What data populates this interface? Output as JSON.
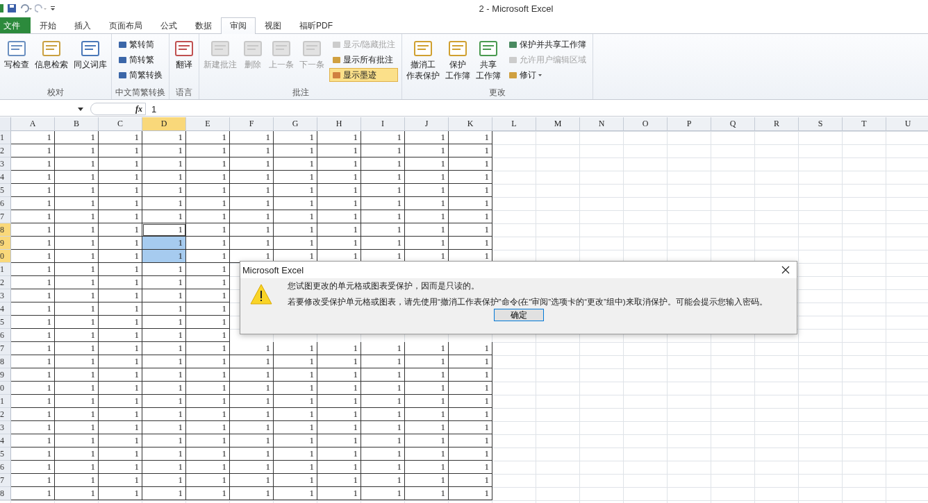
{
  "window": {
    "title": "2 - Microsoft Excel"
  },
  "tabs": [
    {
      "label": "文件",
      "kind": "file",
      "selected": false
    },
    {
      "label": "开始",
      "kind": "tab",
      "selected": false
    },
    {
      "label": "插入",
      "kind": "tab",
      "selected": false
    },
    {
      "label": "页面布局",
      "kind": "tab",
      "selected": false
    },
    {
      "label": "公式",
      "kind": "tab",
      "selected": false
    },
    {
      "label": "数据",
      "kind": "tab",
      "selected": false
    },
    {
      "label": "审阅",
      "kind": "tab",
      "selected": true
    },
    {
      "label": "视图",
      "kind": "tab",
      "selected": false
    },
    {
      "label": "福昕PDF",
      "kind": "tab",
      "selected": false
    }
  ],
  "ribbon": {
    "groups": [
      {
        "label": "校对",
        "large": [
          {
            "lines": [
              "写检查"
            ],
            "disabled": false
          },
          {
            "lines": [
              "信息检索"
            ],
            "disabled": false
          },
          {
            "lines": [
              "同义词库"
            ],
            "disabled": false
          }
        ]
      },
      {
        "label": "中文简繁转换",
        "small": [
          {
            "label": "繁转简",
            "disabled": false,
            "on": false
          },
          {
            "label": "简转繁",
            "disabled": false,
            "on": false
          },
          {
            "label": "简繁转换",
            "disabled": false,
            "on": false
          }
        ]
      },
      {
        "label": "语言",
        "large": [
          {
            "lines": [
              "翻译"
            ],
            "disabled": false
          }
        ]
      },
      {
        "label": "批注",
        "large": [
          {
            "lines": [
              "新建批注"
            ],
            "disabled": true
          },
          {
            "lines": [
              "删除"
            ],
            "disabled": true
          },
          {
            "lines": [
              "上一条"
            ],
            "disabled": true
          },
          {
            "lines": [
              "下一条"
            ],
            "disabled": true
          }
        ],
        "small": [
          {
            "label": "显示/隐藏批注",
            "disabled": true,
            "on": false
          },
          {
            "label": "显示所有批注",
            "disabled": false,
            "on": false
          },
          {
            "label": "显示墨迹",
            "disabled": false,
            "on": true
          }
        ]
      },
      {
        "label": "更改",
        "large": [
          {
            "lines": [
              "撤消工",
              "作表保护"
            ],
            "disabled": false
          },
          {
            "lines": [
              "保护",
              "工作簿"
            ],
            "disabled": false
          },
          {
            "lines": [
              "共享",
              "工作簿"
            ],
            "disabled": false
          }
        ],
        "small": [
          {
            "label": "保护并共享工作簿",
            "disabled": false,
            "on": false
          },
          {
            "label": "允许用户编辑区域",
            "disabled": true,
            "on": false
          },
          {
            "label": "修订",
            "disabled": false,
            "on": false,
            "dropdown": true
          }
        ]
      }
    ]
  },
  "formula_bar": {
    "function_label": "fx",
    "value": "1"
  },
  "sheet": {
    "columns": [
      {
        "label": "A",
        "selected": false
      },
      {
        "label": "B",
        "selected": false
      },
      {
        "label": "C",
        "selected": false
      },
      {
        "label": "D",
        "selected": true
      },
      {
        "label": "E",
        "selected": false
      },
      {
        "label": "F",
        "selected": false
      },
      {
        "label": "G",
        "selected": false
      },
      {
        "label": "H",
        "selected": false
      },
      {
        "label": "I",
        "selected": false
      },
      {
        "label": "J",
        "selected": false
      },
      {
        "label": "K",
        "selected": false
      },
      {
        "label": "L",
        "selected": false
      },
      {
        "label": "M",
        "selected": false
      },
      {
        "label": "N",
        "selected": false
      },
      {
        "label": "O",
        "selected": false
      },
      {
        "label": "P",
        "selected": false
      },
      {
        "label": "Q",
        "selected": false
      },
      {
        "label": "R",
        "selected": false
      },
      {
        "label": "S",
        "selected": false
      },
      {
        "label": "T",
        "selected": false
      },
      {
        "label": "U",
        "selected": false
      }
    ],
    "rows": [
      {
        "label": "1",
        "selected": false,
        "cells": [
          "1",
          "1",
          "1",
          "1",
          "1",
          "1",
          "1",
          "1",
          "1",
          "1",
          "1"
        ]
      },
      {
        "label": "2",
        "selected": false,
        "cells": [
          "1",
          "1",
          "1",
          "1",
          "1",
          "1",
          "1",
          "1",
          "1",
          "1",
          "1"
        ]
      },
      {
        "label": "3",
        "selected": false,
        "cells": [
          "1",
          "1",
          "1",
          "1",
          "1",
          "1",
          "1",
          "1",
          "1",
          "1",
          "1"
        ]
      },
      {
        "label": "4",
        "selected": false,
        "cells": [
          "1",
          "1",
          "1",
          "1",
          "1",
          "1",
          "1",
          "1",
          "1",
          "1",
          "1"
        ]
      },
      {
        "label": "5",
        "selected": false,
        "cells": [
          "1",
          "1",
          "1",
          "1",
          "1",
          "1",
          "1",
          "1",
          "1",
          "1",
          "1"
        ]
      },
      {
        "label": "6",
        "selected": false,
        "cells": [
          "1",
          "1",
          "1",
          "1",
          "1",
          "1",
          "1",
          "1",
          "1",
          "1",
          "1"
        ]
      },
      {
        "label": "7",
        "selected": false,
        "cells": [
          "1",
          "1",
          "1",
          "1",
          "1",
          "1",
          "1",
          "1",
          "1",
          "1",
          "1"
        ]
      },
      {
        "label": "8",
        "selected": true,
        "cells": [
          "1",
          "1",
          "1",
          "1",
          "1",
          "1",
          "1",
          "1",
          "1",
          "1",
          "1"
        ]
      },
      {
        "label": "9",
        "selected": true,
        "cells": [
          "1",
          "1",
          "1",
          "1",
          "1",
          "1",
          "1",
          "1",
          "1",
          "1",
          "1"
        ]
      },
      {
        "label": "0",
        "selected": true,
        "cells": [
          "1",
          "1",
          "1",
          "1",
          "1",
          "1",
          "1",
          "1",
          "1",
          "1",
          "1"
        ]
      },
      {
        "label": "1",
        "selected": false,
        "cells": [
          "1",
          "1",
          "1",
          "1",
          "1"
        ]
      },
      {
        "label": "2",
        "selected": false,
        "cells": [
          "1",
          "1",
          "1",
          "1",
          "1"
        ]
      },
      {
        "label": "3",
        "selected": false,
        "cells": [
          "1",
          "1",
          "1",
          "1",
          "1"
        ]
      },
      {
        "label": "4",
        "selected": false,
        "cells": [
          "1",
          "1",
          "1",
          "1",
          "1"
        ]
      },
      {
        "label": "5",
        "selected": false,
        "cells": [
          "1",
          "1",
          "1",
          "1",
          "1"
        ]
      },
      {
        "label": "6",
        "selected": false,
        "cells": [
          "1",
          "1",
          "1",
          "1",
          "1"
        ]
      },
      {
        "label": "7",
        "selected": false,
        "cells": [
          "1",
          "1",
          "1",
          "1",
          "1",
          "1",
          "1",
          "1",
          "1",
          "1",
          "1"
        ]
      },
      {
        "label": "8",
        "selected": false,
        "cells": [
          "1",
          "1",
          "1",
          "1",
          "1",
          "1",
          "1",
          "1",
          "1",
          "1",
          "1"
        ]
      },
      {
        "label": "9",
        "selected": false,
        "cells": [
          "1",
          "1",
          "1",
          "1",
          "1",
          "1",
          "1",
          "1",
          "1",
          "1",
          "1"
        ]
      },
      {
        "label": "0",
        "selected": false,
        "cells": [
          "1",
          "1",
          "1",
          "1",
          "1",
          "1",
          "1",
          "1",
          "1",
          "1",
          "1"
        ]
      },
      {
        "label": "1",
        "selected": false,
        "cells": [
          "1",
          "1",
          "1",
          "1",
          "1",
          "1",
          "1",
          "1",
          "1",
          "1",
          "1"
        ]
      },
      {
        "label": "2",
        "selected": false,
        "cells": [
          "1",
          "1",
          "1",
          "1",
          "1",
          "1",
          "1",
          "1",
          "1",
          "1",
          "1"
        ]
      },
      {
        "label": "3",
        "selected": false,
        "cells": [
          "1",
          "1",
          "1",
          "1",
          "1",
          "1",
          "1",
          "1",
          "1",
          "1",
          "1"
        ]
      },
      {
        "label": "4",
        "selected": false,
        "cells": [
          "1",
          "1",
          "1",
          "1",
          "1",
          "1",
          "1",
          "1",
          "1",
          "1",
          "1"
        ]
      },
      {
        "label": "5",
        "selected": false,
        "cells": [
          "1",
          "1",
          "1",
          "1",
          "1",
          "1",
          "1",
          "1",
          "1",
          "1",
          "1"
        ]
      },
      {
        "label": "6",
        "selected": false,
        "cells": [
          "1",
          "1",
          "1",
          "1",
          "1",
          "1",
          "1",
          "1",
          "1",
          "1",
          "1"
        ]
      },
      {
        "label": "7",
        "selected": false,
        "cells": [
          "1",
          "1",
          "1",
          "1",
          "1",
          "1",
          "1",
          "1",
          "1",
          "1",
          "1"
        ]
      },
      {
        "label": "8",
        "selected": false,
        "cells": [
          "1",
          "1",
          "1",
          "1",
          "1",
          "1",
          "1",
          "1",
          "1",
          "1",
          "1"
        ]
      }
    ]
  },
  "dialog": {
    "title": "Microsoft Excel",
    "messages": [
      "您试图更改的单元格或图表受保护，因而是只读的。",
      "若要修改受保护单元格或图表，请先使用“撤消工作表保护”命令(在“审阅”选项卡的“更改”组中)来取消保护。可能会提示您输入密码。"
    ],
    "button": "确定"
  }
}
